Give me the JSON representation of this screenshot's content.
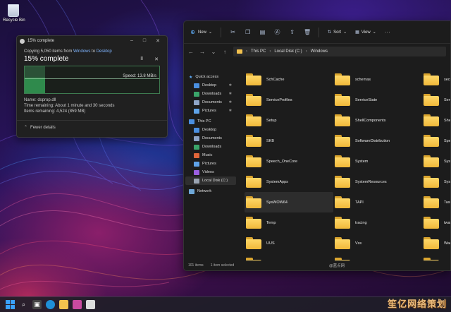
{
  "desktop": {
    "recycle_bin_label": "Recycle Bin"
  },
  "copy_dialog": {
    "title": "15% complete",
    "subtitle_prefix": "Copying 5,050 items from ",
    "source": "Windows",
    "subtitle_mid": " to ",
    "destination": "Desktop",
    "percent_label": "15% complete",
    "progress": 0.15,
    "pause_icon": "pause-icon",
    "cancel_icon": "close-icon",
    "speed": "Speed: 13.8 MB/s",
    "name_line": "Name: dsprop.dll",
    "time_remaining": "Time remaining: About 1 minute and 30 seconds",
    "items_remaining": "Items remaining: 4,524 (859 MB)",
    "fewer_details": "Fewer details",
    "accent_color": "#3a7a4e"
  },
  "explorer": {
    "toolbar": {
      "new_label": "New",
      "sort_label": "Sort",
      "view_label": "View",
      "icons": [
        "cut-icon",
        "copy-icon",
        "paste-icon",
        "rename-icon",
        "share-icon",
        "delete-icon"
      ]
    },
    "breadcrumb": [
      "This PC",
      "Local Disk (C:)",
      "Windows"
    ],
    "nav": {
      "quick_access": "Quick access",
      "quick_items": [
        "Desktop",
        "Downloads",
        "Documents",
        "Pictures"
      ],
      "this_pc": "This PC",
      "pc_items": [
        "Desktop",
        "Documents",
        "Downloads",
        "Music",
        "Pictures",
        "Videos",
        "Local Disk (C:)"
      ],
      "network": "Network"
    },
    "folders_col1": [
      "SchCache",
      "ServiceProfiles",
      "Setup",
      "SKB",
      "Speech_OneCore",
      "SystemApps",
      "SysWOW64",
      "Temp",
      "UUS",
      "Web"
    ],
    "folders_col2": [
      "schemas",
      "ServiceState",
      "ShellComponents",
      "SoftwareDistribution",
      "System",
      "SystemResources",
      "TAPI",
      "tracing",
      "Vss",
      "WinSxS"
    ],
    "folders_col3": [
      "securi",
      "Servic",
      "ShellE",
      "Speec",
      "Syster",
      "Syster",
      "Tasks",
      "twain_",
      "WaaS",
      "WUMo"
    ],
    "status_count": "101 items",
    "status_selected": "1 item selected"
  },
  "watermark": {
    "small": "@蓝点网",
    "large": "笙亿网络策划"
  }
}
